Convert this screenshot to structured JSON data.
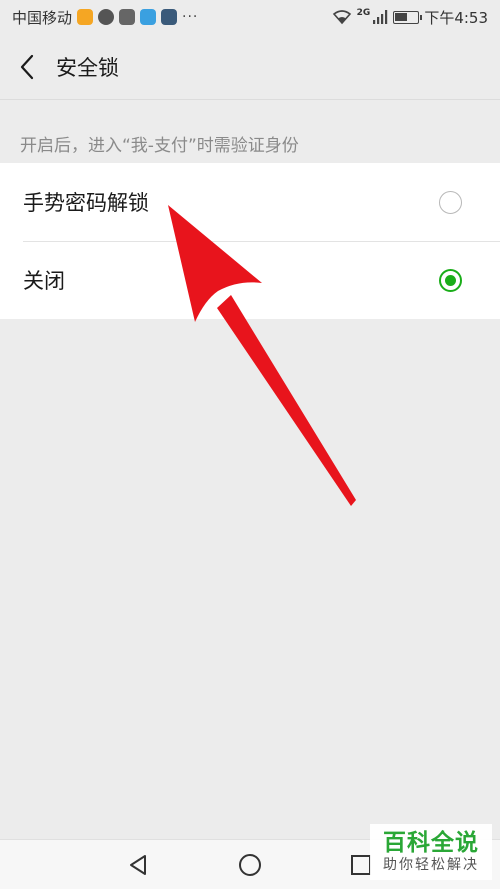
{
  "status_bar": {
    "carrier": "中国移动",
    "network": "2G",
    "time": "下午4:53",
    "battery_level": 0.55,
    "overflow": "···"
  },
  "header": {
    "title": "安全锁",
    "back_icon": "chevron-left-icon"
  },
  "section": {
    "hint": "开启后，进入“我-支付”时需验证身份"
  },
  "options": [
    {
      "label": "手势密码解锁",
      "selected": false
    },
    {
      "label": "关闭",
      "selected": true
    }
  ],
  "nav_bar": {
    "back_icon": "triangle-back-icon",
    "home_icon": "circle-home-icon",
    "recent_icon": "square-recent-icon"
  },
  "watermark": {
    "title": "百科全说",
    "subtitle": "助你轻松解决"
  },
  "colors": {
    "accent": "#1aad19",
    "background": "#ececec",
    "annotation_arrow": "#e8141c"
  }
}
